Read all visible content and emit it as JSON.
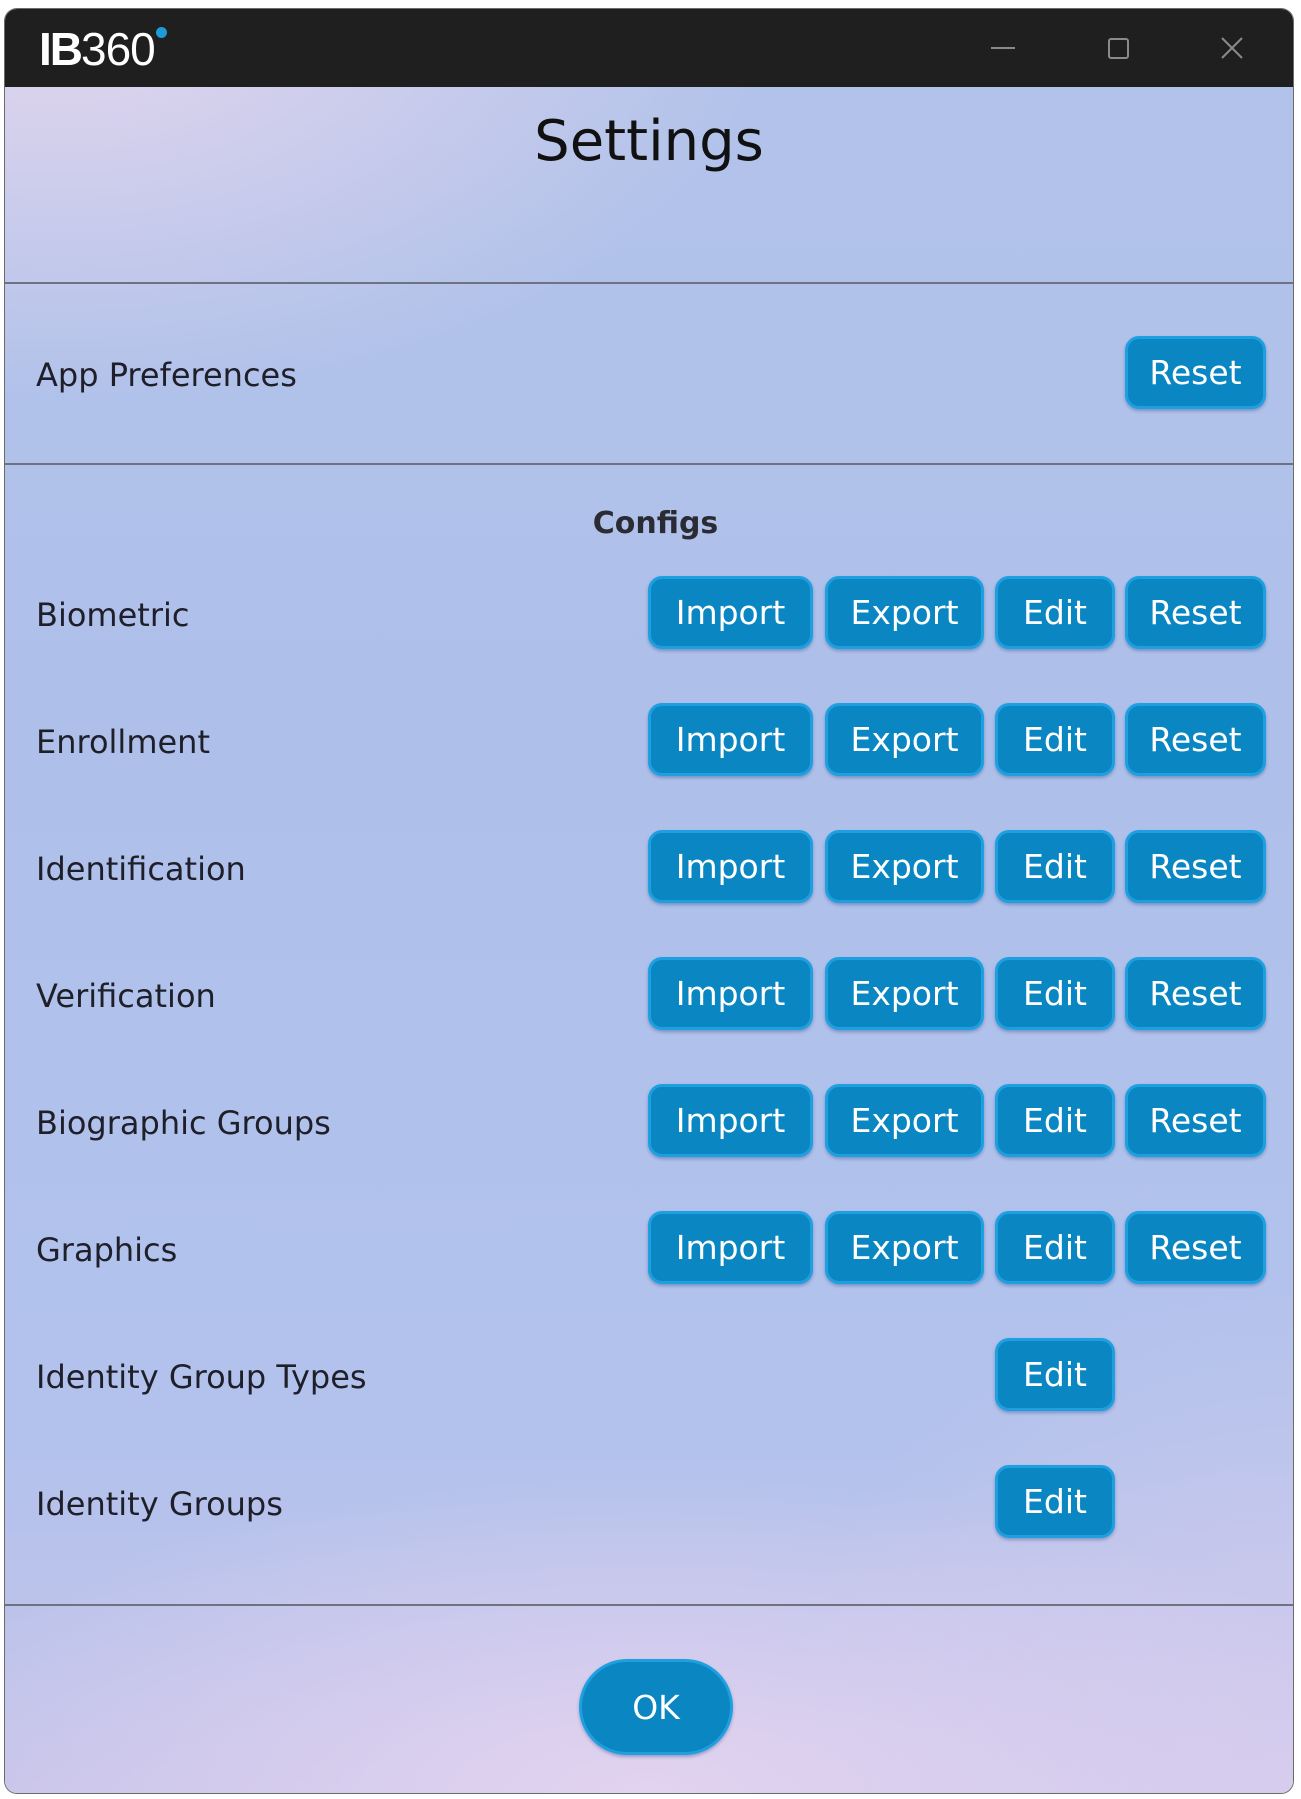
{
  "window": {
    "logo": {
      "ib": "IB",
      "num": "360"
    },
    "controls": [
      "minimize-icon",
      "maximize-icon",
      "close-icon"
    ]
  },
  "page_title": "Settings",
  "app_preferences": {
    "label": "App Preferences",
    "reset_label": "Reset"
  },
  "configs": {
    "title": "Configs",
    "rows": [
      {
        "label": "Biometric",
        "import": "Import",
        "export": "Export",
        "edit": "Edit",
        "reset": "Reset"
      },
      {
        "label": "Enrollment",
        "import": "Import",
        "export": "Export",
        "edit": "Edit",
        "reset": "Reset"
      },
      {
        "label": "Identification",
        "import": "Import",
        "export": "Export",
        "edit": "Edit",
        "reset": "Reset"
      },
      {
        "label": "Verification",
        "import": "Import",
        "export": "Export",
        "edit": "Edit",
        "reset": "Reset"
      },
      {
        "label": "Biographic Groups",
        "import": "Import",
        "export": "Export",
        "edit": "Edit",
        "reset": "Reset"
      },
      {
        "label": "Graphics",
        "import": "Import",
        "export": "Export",
        "edit": "Edit",
        "reset": "Reset"
      },
      {
        "label": "Identity Group Types",
        "edit": "Edit"
      },
      {
        "label": "Identity Groups",
        "edit": "Edit"
      }
    ]
  },
  "ok_label": "OK",
  "colors": {
    "button_fill": "#0a86c2",
    "button_border": "#1ea0e0",
    "titlebar": "#1f1f1f",
    "logo_dot": "#1e9bd7"
  }
}
